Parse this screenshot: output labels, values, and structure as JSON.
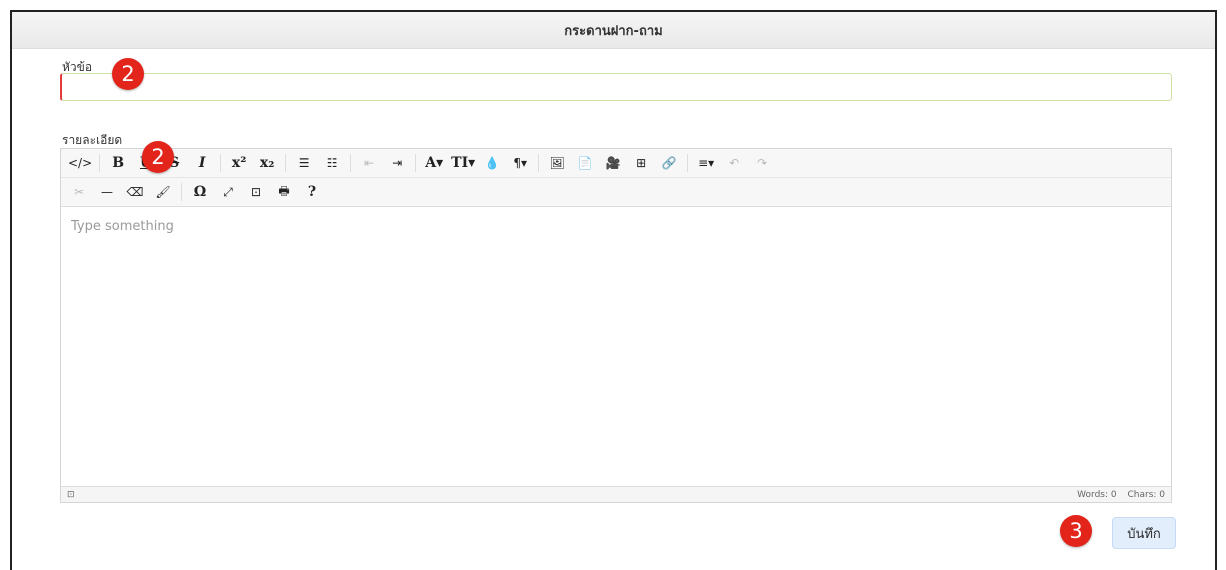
{
  "dialog": {
    "title": "กระดานฝาก-ถาม"
  },
  "subject": {
    "label": "หัวข้อ",
    "value": ""
  },
  "detail": {
    "label": "รายละเอียด"
  },
  "editor": {
    "placeholder": "Type something",
    "toolbar_row1": [
      "</>",
      "B",
      "U",
      "S",
      "I",
      "x²",
      "x₂",
      "☰",
      "☷",
      "⇤",
      "⇥",
      "A▾",
      "TI▾",
      "💧",
      "¶▾",
      "🖼",
      "📄",
      "🎥",
      "⊞",
      "🔗",
      "≡▾",
      "↶",
      "↷"
    ],
    "toolbar_row2": [
      "✂",
      "—",
      "⌫",
      "🖌",
      "Ω",
      "⤢",
      "⊡",
      "🖶",
      "?"
    ],
    "status": {
      "left_icon": "⊡",
      "words": "Words: 0",
      "chars": "Chars: 0"
    }
  },
  "save_button": {
    "label": "บันทึก"
  },
  "annotations": {
    "badge_subject": "2",
    "badge_toolbar": "2",
    "badge_save": "3"
  },
  "colors": {
    "badge": "#e2241b",
    "save_bg": "#e3eefc",
    "input_border": "#cfe0a6"
  }
}
